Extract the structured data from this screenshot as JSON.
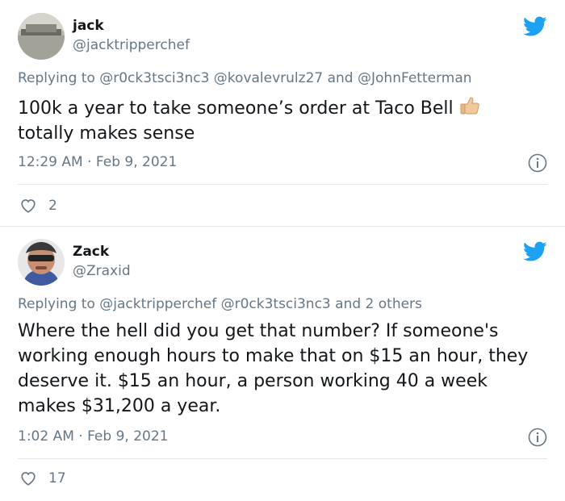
{
  "tweets": [
    {
      "name": "jack",
      "handle": "@jacktripperchef",
      "reply_prefix": "Replying to",
      "reply_to": "@r0ck3tsci3nc3 @kovalevrulz27 and @JohnFetterman",
      "text": "100k a year to take someone’s order at Taco Bell",
      "text_line2": "totally makes sense",
      "emoji": "thumbs-up",
      "timestamp": "12:29 AM · Feb 9, 2021",
      "likes": "2"
    },
    {
      "name": "Zack",
      "handle": "@Zraxid",
      "reply_prefix": "Replying to",
      "reply_to": "@jacktripperchef @r0ck3tsci3nc3 and 2 others",
      "text": "Where the hell did you get that number? If someone's working enough hours to make that on $15 an hour, they deserve it. $15 an hour, a person working 40 a week makes $31,200 a year.",
      "timestamp": "1:02 AM · Feb 9, 2021",
      "likes": "17"
    }
  ],
  "colors": {
    "twitter_blue": "#1da1f2",
    "secondary_text": "#657786",
    "divider": "#e1e8ed"
  },
  "icons": [
    "twitter-bird-icon",
    "info-icon",
    "heart-icon",
    "thumbs-up-emoji"
  ]
}
